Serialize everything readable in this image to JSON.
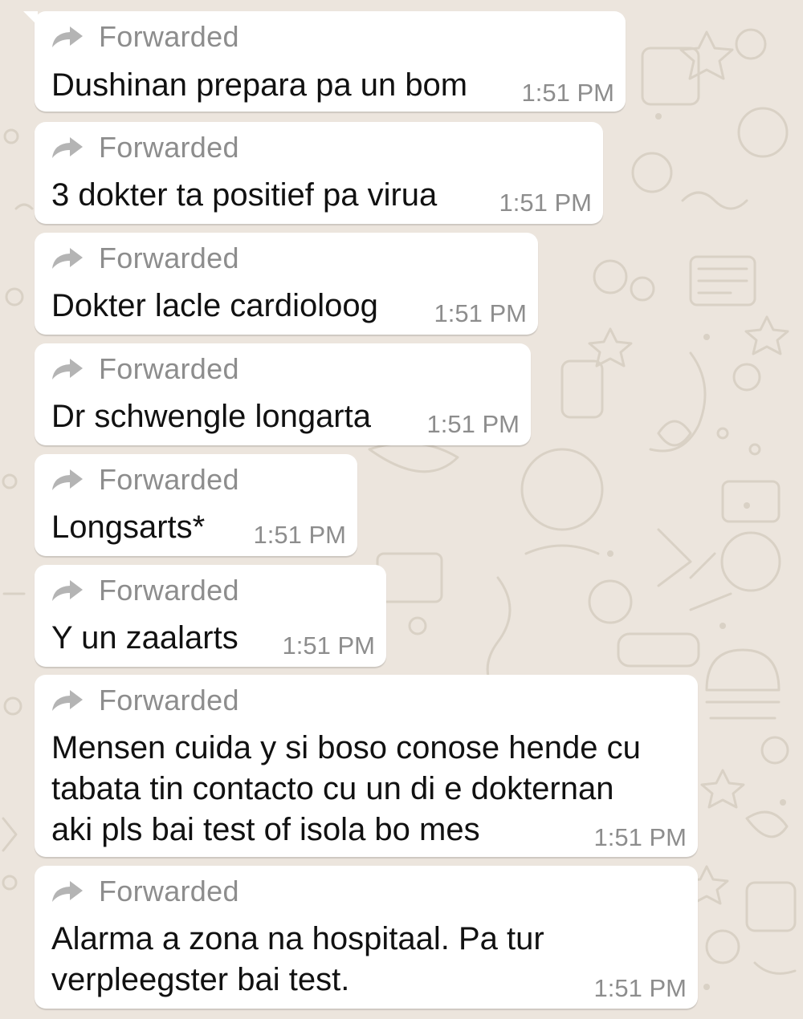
{
  "colors": {
    "wallpaper": "#ece5dd",
    "bubble": "#ffffff",
    "meta_text": "#8d8d8d",
    "message_text": "#111111"
  },
  "forwarded_icon": "forward-arrow-icon",
  "messages": [
    {
      "forwarded_label": "Forwarded",
      "text": "Dushinan prepara pa un bom",
      "time": "1:51 PM"
    },
    {
      "forwarded_label": "Forwarded",
      "text": "3 dokter ta positief pa virua",
      "time": "1:51 PM"
    },
    {
      "forwarded_label": "Forwarded",
      "text": "Dokter lacle cardioloog",
      "time": "1:51 PM"
    },
    {
      "forwarded_label": "Forwarded",
      "text": "Dr schwengle longarta",
      "time": "1:51 PM"
    },
    {
      "forwarded_label": "Forwarded",
      "text": "Longsarts*",
      "time": "1:51 PM"
    },
    {
      "forwarded_label": "Forwarded",
      "text": "Y un zaalarts",
      "time": "1:51 PM"
    },
    {
      "forwarded_label": "Forwarded",
      "text": "Mensen cuida y si boso conose hende cu\ntabata tin contacto cu un di e dokternan\naki pls bai test of isola bo mes",
      "time": "1:51 PM"
    },
    {
      "forwarded_label": "Forwarded",
      "text": "Alarma a zona na hospitaal. Pa tur\nverpleegster bai test.",
      "time": "1:51 PM"
    }
  ]
}
